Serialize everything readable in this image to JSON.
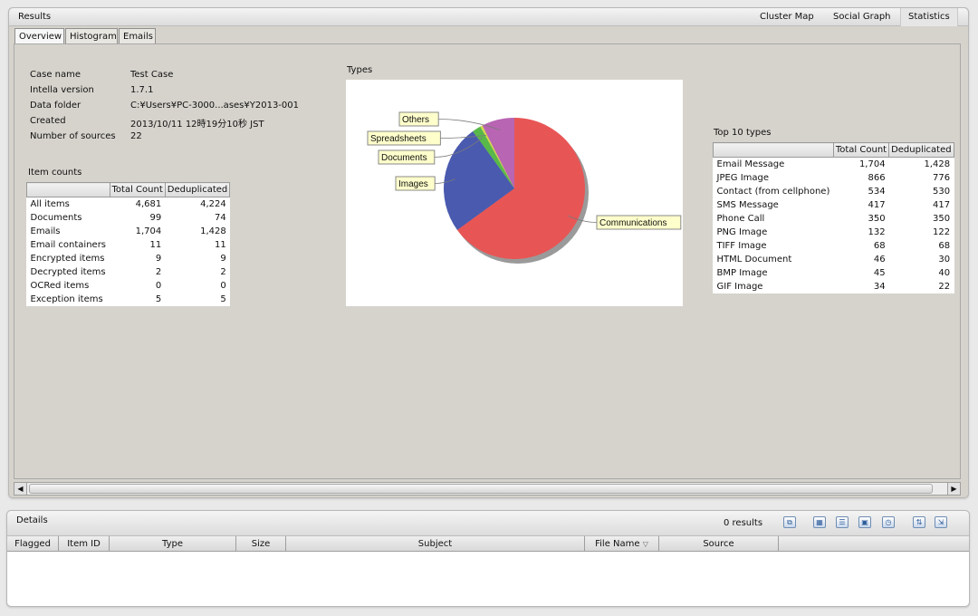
{
  "results": {
    "title": "Results",
    "view_tabs": [
      "Cluster Map",
      "Social Graph",
      "Statistics"
    ],
    "sub_tabs": [
      "Overview",
      "Histogram",
      "Emails"
    ]
  },
  "overview": {
    "case_name_label": "Case name",
    "case_name_value": "Test Case",
    "version_label": "Intella version",
    "version_value": "1.7.1",
    "folder_label": "Data folder",
    "folder_value": "C:¥Users¥PC-3000...ases¥Y2013-001",
    "created_label": "Created",
    "created_value": "2013/10/11 12時19分10秒 JST",
    "sources_label": "Number of sources",
    "sources_value": "22"
  },
  "item_counts": {
    "title": "Item counts",
    "headers": [
      "",
      "Total Count",
      "Deduplicated"
    ],
    "rows": [
      [
        "All items",
        "4,681",
        "4,224"
      ],
      [
        "Documents",
        "99",
        "74"
      ],
      [
        "Emails",
        "1,704",
        "1,428"
      ],
      [
        "Email containers",
        "11",
        "11"
      ],
      [
        "Encrypted items",
        "9",
        "9"
      ],
      [
        "Decrypted items",
        "2",
        "2"
      ],
      [
        "OCRed items",
        "0",
        "0"
      ],
      [
        "Exception items",
        "5",
        "5"
      ]
    ]
  },
  "types_label": "Types",
  "chart_data": {
    "type": "pie",
    "title": "",
    "slices": [
      {
        "label": "Communications",
        "value": 65,
        "color": "#e85555"
      },
      {
        "label": "Images",
        "value": 25,
        "color": "#4a5aae"
      },
      {
        "label": "Documents",
        "value": 2,
        "color": "#59b84a"
      },
      {
        "label": "Spreadsheets",
        "value": 0.5,
        "color": "#d6d84c"
      },
      {
        "label": "Others",
        "value": 7.5,
        "color": "#b865b3"
      }
    ]
  },
  "top_types": {
    "title": "Top 10 types",
    "headers": [
      "",
      "Total Count",
      "Deduplicated"
    ],
    "rows": [
      [
        "Email Message",
        "1,704",
        "1,428"
      ],
      [
        "JPEG Image",
        "866",
        "776"
      ],
      [
        "Contact (from cellphone)",
        "534",
        "530"
      ],
      [
        "SMS Message",
        "417",
        "417"
      ],
      [
        "Phone Call",
        "350",
        "350"
      ],
      [
        "PNG Image",
        "132",
        "122"
      ],
      [
        "TIFF Image",
        "68",
        "68"
      ],
      [
        "HTML Document",
        "46",
        "30"
      ],
      [
        "BMP Image",
        "45",
        "40"
      ],
      [
        "GIF Image",
        "34",
        "22"
      ]
    ]
  },
  "details": {
    "title": "Details",
    "result_count": "0 results",
    "columns": [
      "Flagged",
      "Item ID",
      "Type",
      "Size",
      "Subject",
      "File Name",
      "Source"
    ]
  }
}
